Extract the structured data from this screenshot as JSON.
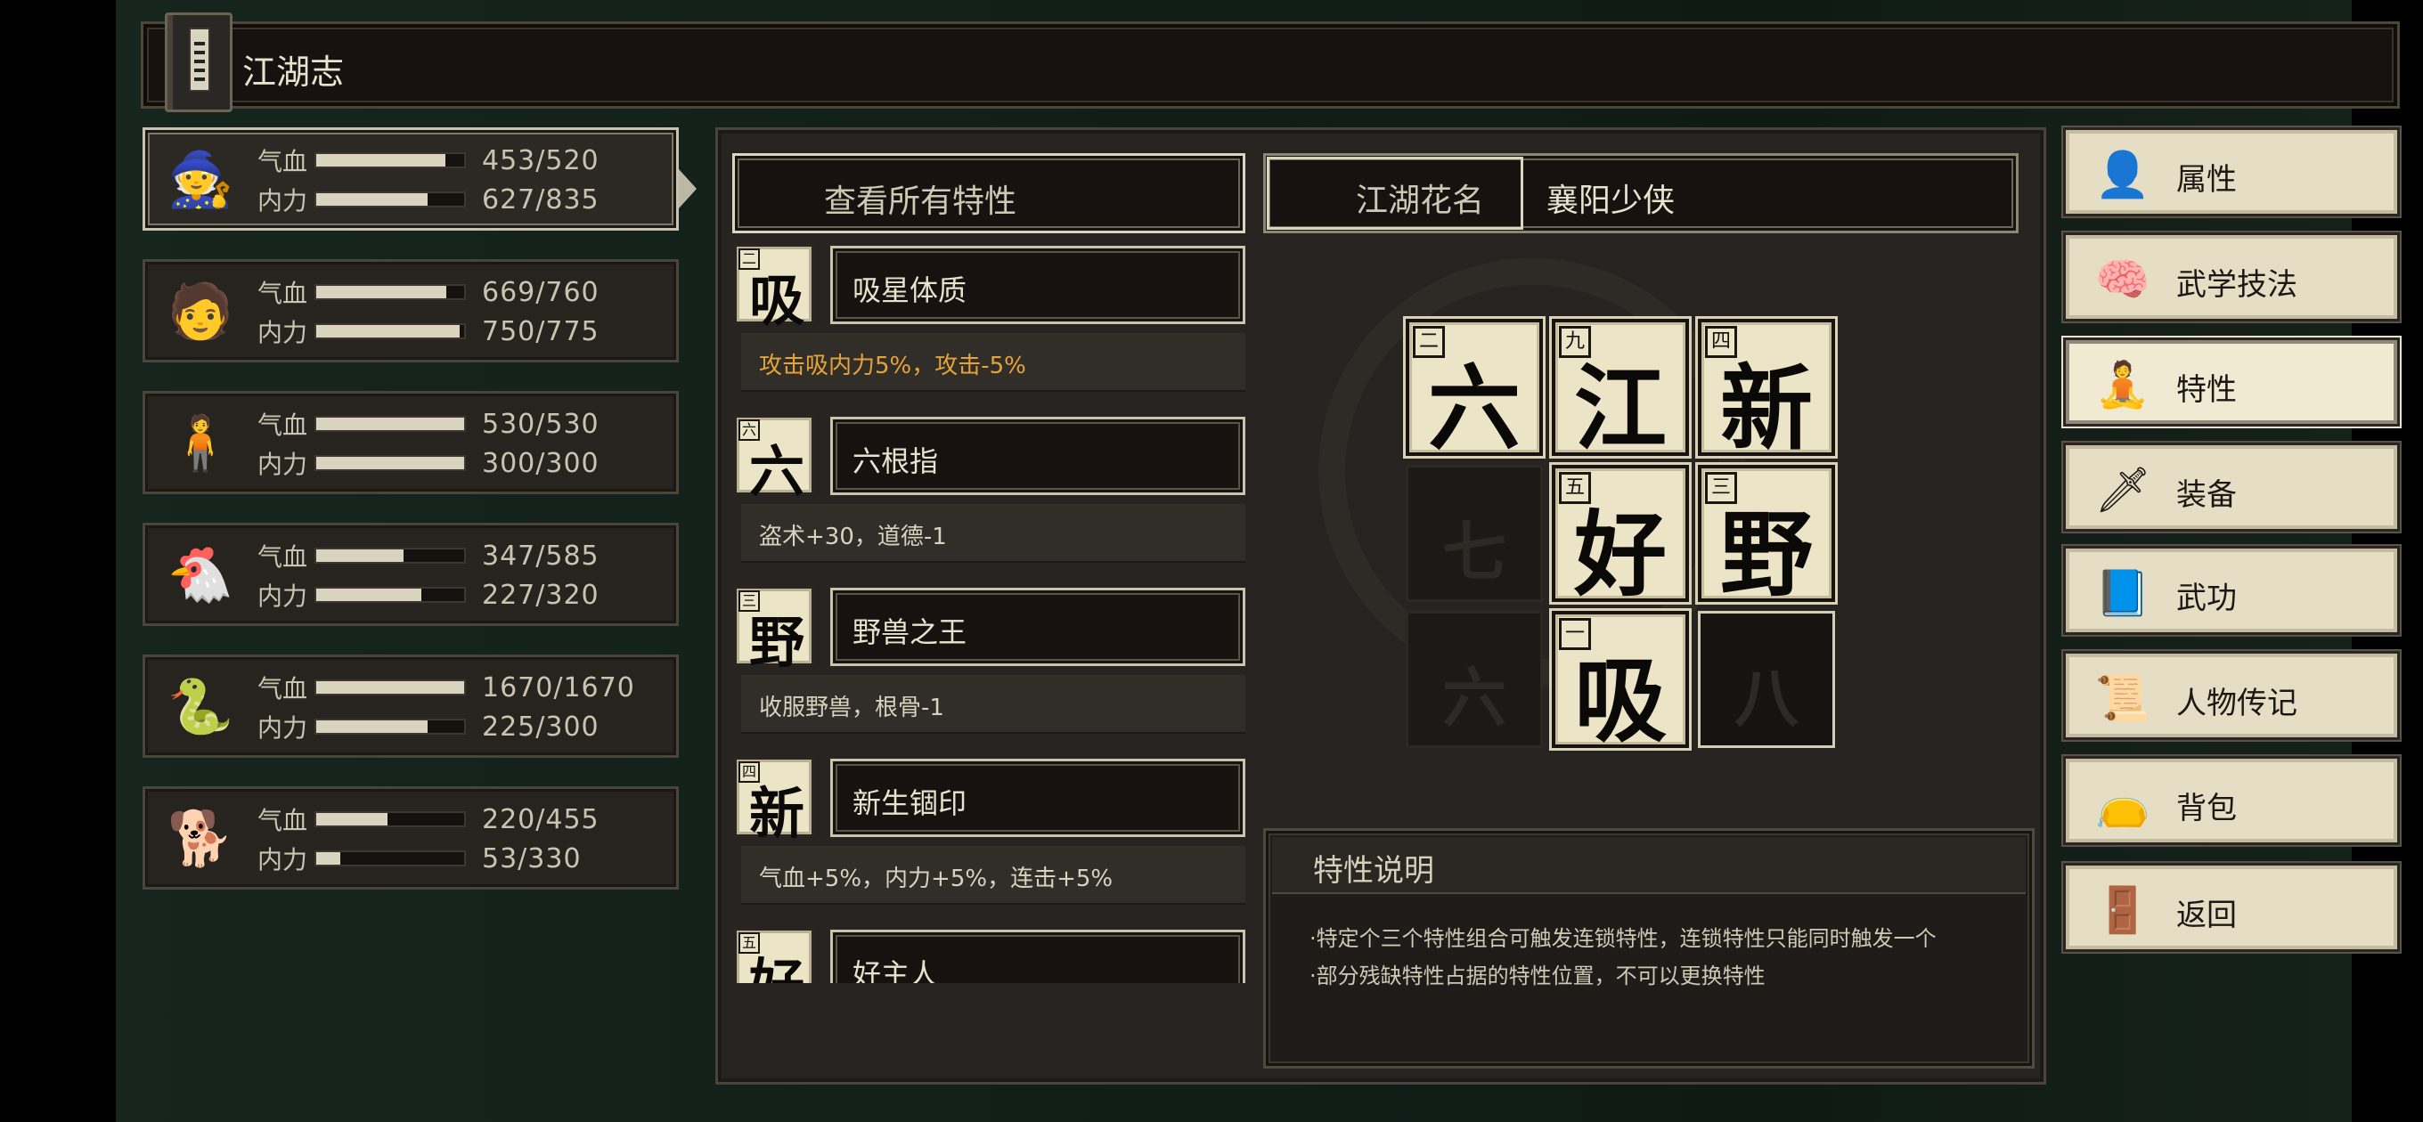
{
  "header": {
    "title": "江湖志",
    "book_icon": "book-icon"
  },
  "characters": [
    {
      "avatar": "🧙",
      "hp_label": "气血",
      "mp_label": "内力",
      "hp": "453/520",
      "mp": "627/835",
      "hp_ratio": 0.871,
      "mp_ratio": 0.751
    },
    {
      "avatar": "🧑",
      "hp_label": "气血",
      "mp_label": "内力",
      "hp": "669/760",
      "mp": "750/775",
      "hp_ratio": 0.88,
      "mp_ratio": 0.968
    },
    {
      "avatar": "🧍",
      "hp_label": "气血",
      "mp_label": "内力",
      "hp": "530/530",
      "mp": "300/300",
      "hp_ratio": 1.0,
      "mp_ratio": 1.0
    },
    {
      "avatar": "🐔",
      "hp_label": "气血",
      "mp_label": "内力",
      "hp": "347/585",
      "mp": "227/320",
      "hp_ratio": 0.593,
      "mp_ratio": 0.709
    },
    {
      "avatar": "🐍",
      "hp_label": "气血",
      "mp_label": "内力",
      "hp": "1670/1670",
      "mp": "225/300",
      "hp_ratio": 1.0,
      "mp_ratio": 0.75
    },
    {
      "avatar": "🐕",
      "hp_label": "气血",
      "mp_label": "内力",
      "hp": "220/455",
      "mp": "53/330",
      "hp_ratio": 0.484,
      "mp_ratio": 0.161
    }
  ],
  "traits_panel": {
    "view_all_label": "查看所有特性",
    "nickname_label": "江湖花名",
    "nickname_value": "襄阳少侠"
  },
  "traits": [
    {
      "num": "二",
      "char": "吸",
      "name": "吸星体质",
      "effect": "攻击吸内力5%，攻击-5%",
      "highlight": true
    },
    {
      "num": "六",
      "char": "六",
      "name": "六根指",
      "effect": "盗术+30，道德-1",
      "highlight": false
    },
    {
      "num": "三",
      "char": "野",
      "name": "野兽之王",
      "effect": "收服野兽，根骨-1",
      "highlight": false
    },
    {
      "num": "四",
      "char": "新",
      "name": "新生锢印",
      "effect": "气血+5%，内力+5%，连击+5%",
      "highlight": false
    },
    {
      "num": "五",
      "char": "好",
      "name": "好主人",
      "effect": "",
      "highlight": false
    }
  ],
  "grid": [
    {
      "state": "filled",
      "num": "二",
      "char": "六"
    },
    {
      "state": "filled",
      "num": "九",
      "char": "江"
    },
    {
      "state": "filled",
      "num": "四",
      "char": "新"
    },
    {
      "state": "locked",
      "num": "",
      "char": "七"
    },
    {
      "state": "filled",
      "num": "五",
      "char": "好"
    },
    {
      "state": "filled",
      "num": "三",
      "char": "野"
    },
    {
      "state": "locked",
      "num": "",
      "char": "六"
    },
    {
      "state": "filled",
      "num": "一",
      "char": "吸"
    },
    {
      "state": "empty",
      "num": "",
      "char": "八"
    }
  ],
  "description": {
    "title": "特性说明",
    "lines": [
      "·特定个三个特性组合可触发连锁特性，连锁特性只能同时触发一个",
      "·部分残缺特性占据的特性位置，不可以更换特性"
    ]
  },
  "menu": [
    {
      "label": "属性",
      "icon": "👤",
      "icon_name": "attributes-icon",
      "active": false
    },
    {
      "label": "武学技法",
      "icon": "🧠",
      "icon_name": "martial-skills-icon",
      "active": false
    },
    {
      "label": "特性",
      "icon": "🧘",
      "icon_name": "traits-icon",
      "active": true
    },
    {
      "label": "装备",
      "icon": "🗡",
      "icon_name": "equipment-icon",
      "active": false
    },
    {
      "label": "武功",
      "icon": "📘",
      "icon_name": "kungfu-book-icon",
      "active": false
    },
    {
      "label": "人物传记",
      "icon": "📜",
      "icon_name": "biography-icon",
      "active": false
    },
    {
      "label": "背包",
      "icon": "👝",
      "icon_name": "bag-icon",
      "active": false
    },
    {
      "label": "返回",
      "icon": "🚪",
      "icon_name": "return-door-icon",
      "active": false
    }
  ]
}
